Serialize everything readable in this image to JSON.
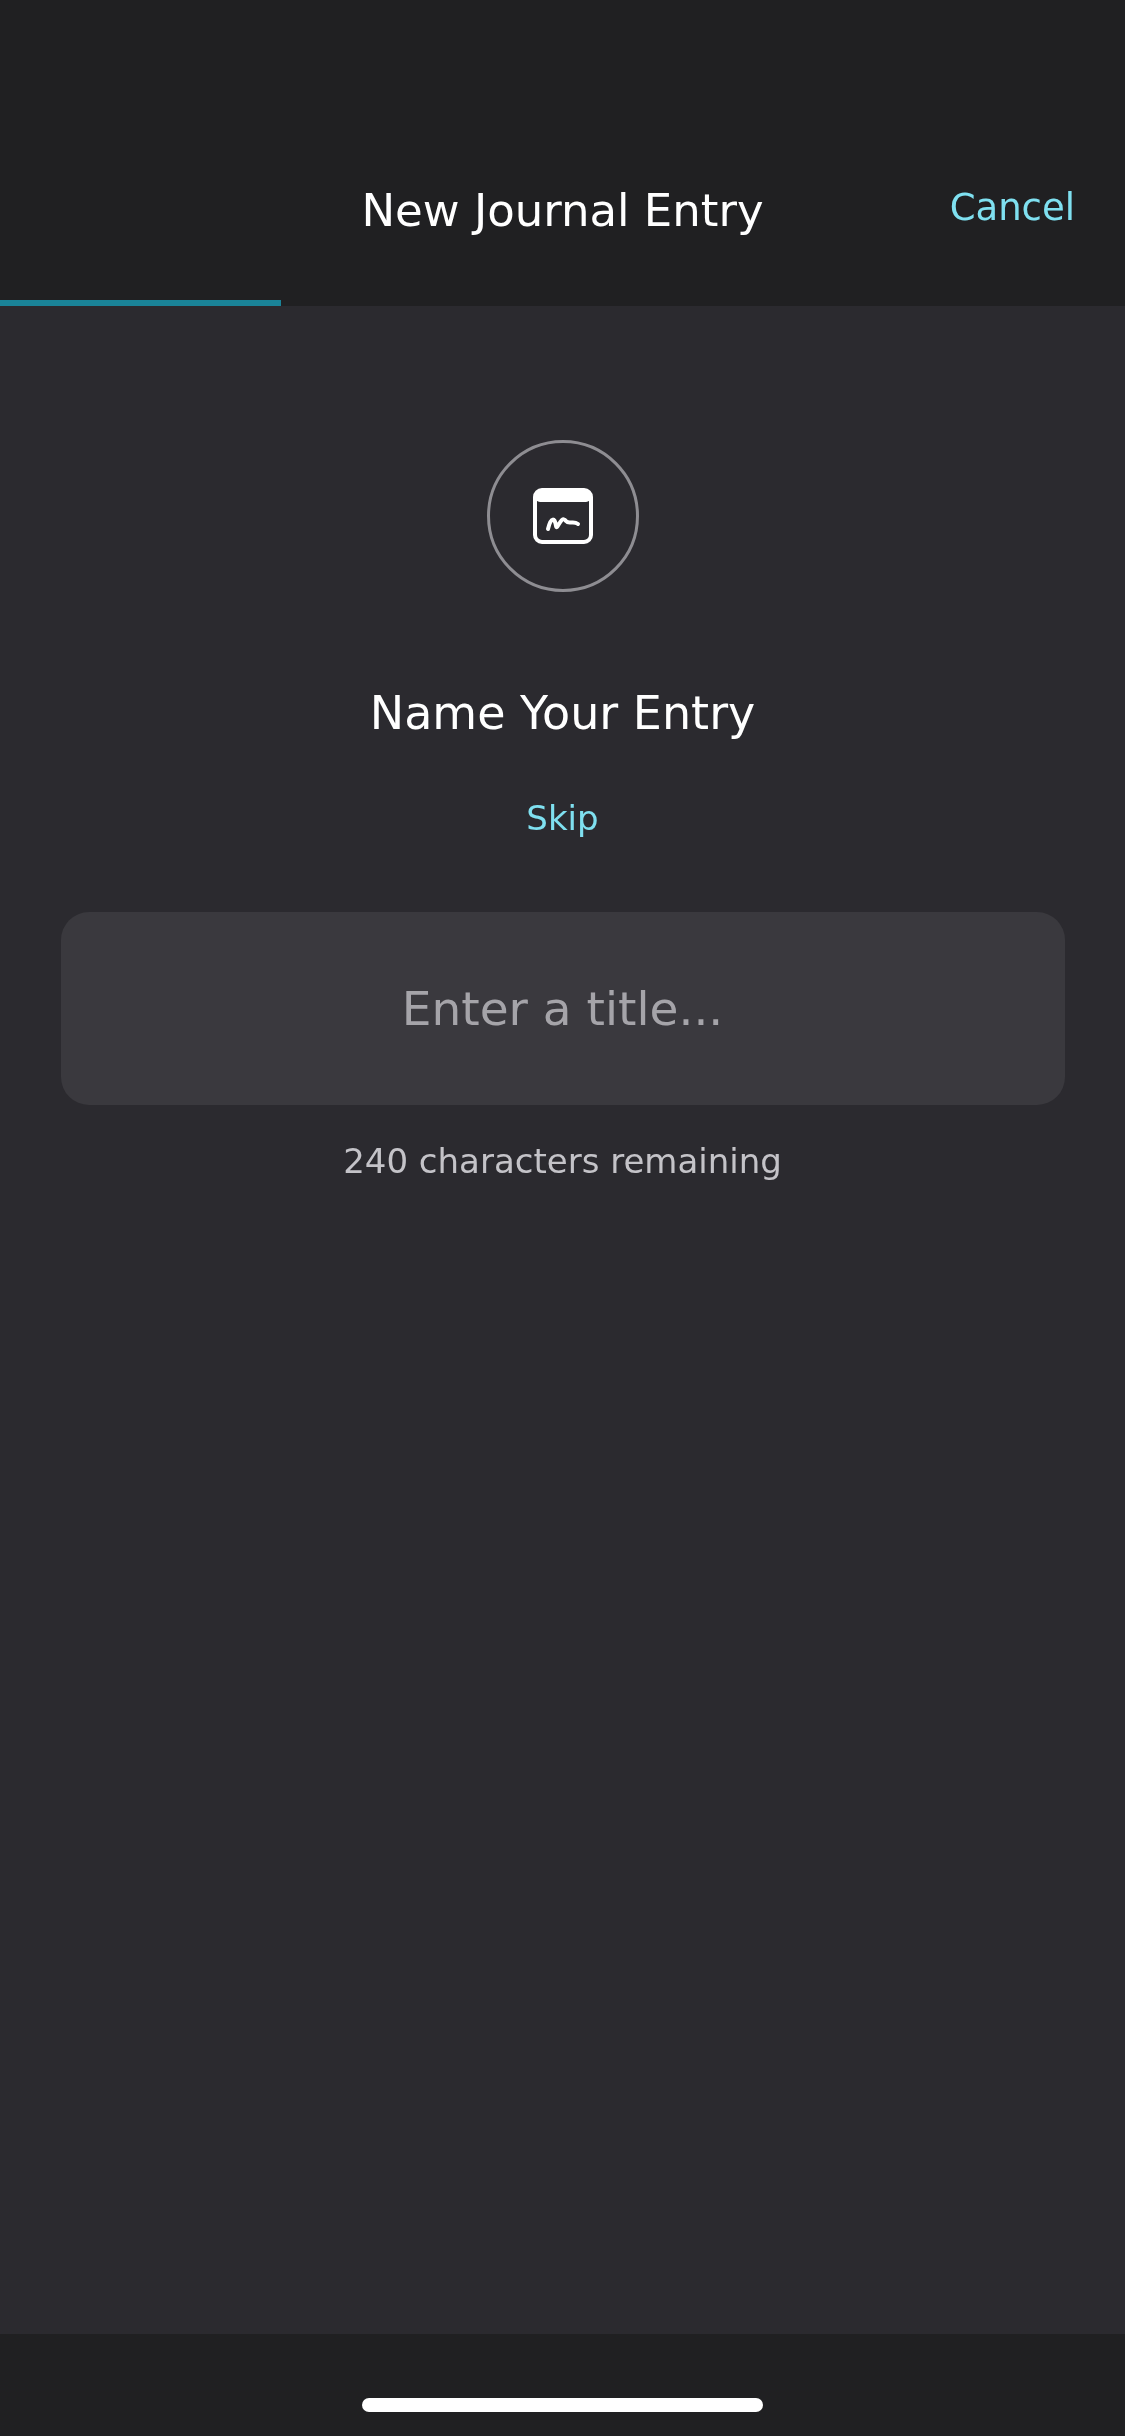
{
  "header": {
    "title": "New Journal Entry",
    "cancel": "Cancel"
  },
  "progress": {
    "level": 0.25
  },
  "prompt": {
    "heading": "Name Your Entry",
    "skip": "Skip"
  },
  "title_field": {
    "placeholder": "Enter a title...",
    "counter": "240 characters remaining"
  }
}
